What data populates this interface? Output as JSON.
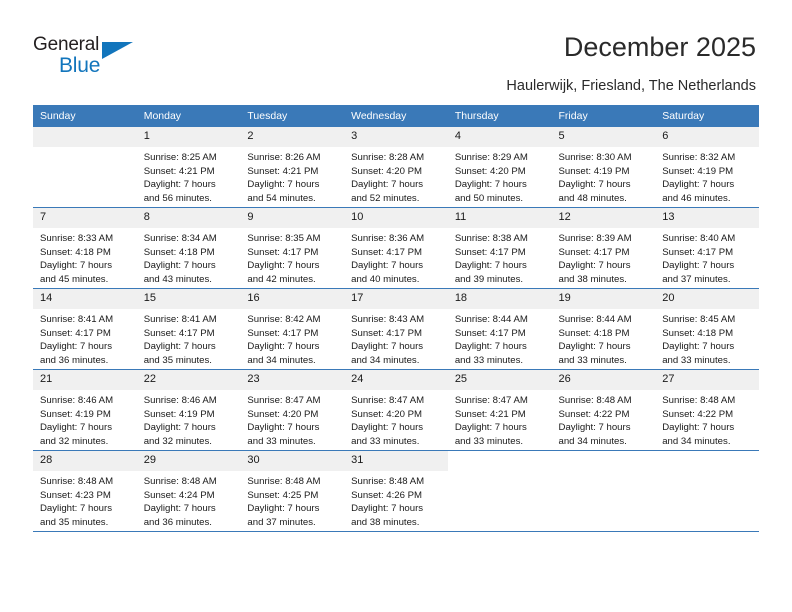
{
  "brand": {
    "name_top": "General",
    "name_bottom": "Blue",
    "triangle_color": "#1275bc"
  },
  "header": {
    "title": "December 2025",
    "subtitle": "Haulerwijk, Friesland, The Netherlands",
    "header_bg": "#3a79b8"
  },
  "weekdays": [
    "Sunday",
    "Monday",
    "Tuesday",
    "Wednesday",
    "Thursday",
    "Friday",
    "Saturday"
  ],
  "weeks": [
    [
      {
        "day": "",
        "sunrise": "",
        "sunset": "",
        "daylight1": "",
        "daylight2": "",
        "empty": true
      },
      {
        "day": "1",
        "sunrise": "Sunrise: 8:25 AM",
        "sunset": "Sunset: 4:21 PM",
        "daylight1": "Daylight: 7 hours",
        "daylight2": "and 56 minutes."
      },
      {
        "day": "2",
        "sunrise": "Sunrise: 8:26 AM",
        "sunset": "Sunset: 4:21 PM",
        "daylight1": "Daylight: 7 hours",
        "daylight2": "and 54 minutes."
      },
      {
        "day": "3",
        "sunrise": "Sunrise: 8:28 AM",
        "sunset": "Sunset: 4:20 PM",
        "daylight1": "Daylight: 7 hours",
        "daylight2": "and 52 minutes."
      },
      {
        "day": "4",
        "sunrise": "Sunrise: 8:29 AM",
        "sunset": "Sunset: 4:20 PM",
        "daylight1": "Daylight: 7 hours",
        "daylight2": "and 50 minutes."
      },
      {
        "day": "5",
        "sunrise": "Sunrise: 8:30 AM",
        "sunset": "Sunset: 4:19 PM",
        "daylight1": "Daylight: 7 hours",
        "daylight2": "and 48 minutes."
      },
      {
        "day": "6",
        "sunrise": "Sunrise: 8:32 AM",
        "sunset": "Sunset: 4:19 PM",
        "daylight1": "Daylight: 7 hours",
        "daylight2": "and 46 minutes."
      }
    ],
    [
      {
        "day": "7",
        "sunrise": "Sunrise: 8:33 AM",
        "sunset": "Sunset: 4:18 PM",
        "daylight1": "Daylight: 7 hours",
        "daylight2": "and 45 minutes."
      },
      {
        "day": "8",
        "sunrise": "Sunrise: 8:34 AM",
        "sunset": "Sunset: 4:18 PM",
        "daylight1": "Daylight: 7 hours",
        "daylight2": "and 43 minutes."
      },
      {
        "day": "9",
        "sunrise": "Sunrise: 8:35 AM",
        "sunset": "Sunset: 4:17 PM",
        "daylight1": "Daylight: 7 hours",
        "daylight2": "and 42 minutes."
      },
      {
        "day": "10",
        "sunrise": "Sunrise: 8:36 AM",
        "sunset": "Sunset: 4:17 PM",
        "daylight1": "Daylight: 7 hours",
        "daylight2": "and 40 minutes."
      },
      {
        "day": "11",
        "sunrise": "Sunrise: 8:38 AM",
        "sunset": "Sunset: 4:17 PM",
        "daylight1": "Daylight: 7 hours",
        "daylight2": "and 39 minutes."
      },
      {
        "day": "12",
        "sunrise": "Sunrise: 8:39 AM",
        "sunset": "Sunset: 4:17 PM",
        "daylight1": "Daylight: 7 hours",
        "daylight2": "and 38 minutes."
      },
      {
        "day": "13",
        "sunrise": "Sunrise: 8:40 AM",
        "sunset": "Sunset: 4:17 PM",
        "daylight1": "Daylight: 7 hours",
        "daylight2": "and 37 minutes."
      }
    ],
    [
      {
        "day": "14",
        "sunrise": "Sunrise: 8:41 AM",
        "sunset": "Sunset: 4:17 PM",
        "daylight1": "Daylight: 7 hours",
        "daylight2": "and 36 minutes."
      },
      {
        "day": "15",
        "sunrise": "Sunrise: 8:41 AM",
        "sunset": "Sunset: 4:17 PM",
        "daylight1": "Daylight: 7 hours",
        "daylight2": "and 35 minutes."
      },
      {
        "day": "16",
        "sunrise": "Sunrise: 8:42 AM",
        "sunset": "Sunset: 4:17 PM",
        "daylight1": "Daylight: 7 hours",
        "daylight2": "and 34 minutes."
      },
      {
        "day": "17",
        "sunrise": "Sunrise: 8:43 AM",
        "sunset": "Sunset: 4:17 PM",
        "daylight1": "Daylight: 7 hours",
        "daylight2": "and 34 minutes."
      },
      {
        "day": "18",
        "sunrise": "Sunrise: 8:44 AM",
        "sunset": "Sunset: 4:17 PM",
        "daylight1": "Daylight: 7 hours",
        "daylight2": "and 33 minutes."
      },
      {
        "day": "19",
        "sunrise": "Sunrise: 8:44 AM",
        "sunset": "Sunset: 4:18 PM",
        "daylight1": "Daylight: 7 hours",
        "daylight2": "and 33 minutes."
      },
      {
        "day": "20",
        "sunrise": "Sunrise: 8:45 AM",
        "sunset": "Sunset: 4:18 PM",
        "daylight1": "Daylight: 7 hours",
        "daylight2": "and 33 minutes."
      }
    ],
    [
      {
        "day": "21",
        "sunrise": "Sunrise: 8:46 AM",
        "sunset": "Sunset: 4:19 PM",
        "daylight1": "Daylight: 7 hours",
        "daylight2": "and 32 minutes."
      },
      {
        "day": "22",
        "sunrise": "Sunrise: 8:46 AM",
        "sunset": "Sunset: 4:19 PM",
        "daylight1": "Daylight: 7 hours",
        "daylight2": "and 32 minutes."
      },
      {
        "day": "23",
        "sunrise": "Sunrise: 8:47 AM",
        "sunset": "Sunset: 4:20 PM",
        "daylight1": "Daylight: 7 hours",
        "daylight2": "and 33 minutes."
      },
      {
        "day": "24",
        "sunrise": "Sunrise: 8:47 AM",
        "sunset": "Sunset: 4:20 PM",
        "daylight1": "Daylight: 7 hours",
        "daylight2": "and 33 minutes."
      },
      {
        "day": "25",
        "sunrise": "Sunrise: 8:47 AM",
        "sunset": "Sunset: 4:21 PM",
        "daylight1": "Daylight: 7 hours",
        "daylight2": "and 33 minutes."
      },
      {
        "day": "26",
        "sunrise": "Sunrise: 8:48 AM",
        "sunset": "Sunset: 4:22 PM",
        "daylight1": "Daylight: 7 hours",
        "daylight2": "and 34 minutes."
      },
      {
        "day": "27",
        "sunrise": "Sunrise: 8:48 AM",
        "sunset": "Sunset: 4:22 PM",
        "daylight1": "Daylight: 7 hours",
        "daylight2": "and 34 minutes."
      }
    ],
    [
      {
        "day": "28",
        "sunrise": "Sunrise: 8:48 AM",
        "sunset": "Sunset: 4:23 PM",
        "daylight1": "Daylight: 7 hours",
        "daylight2": "and 35 minutes."
      },
      {
        "day": "29",
        "sunrise": "Sunrise: 8:48 AM",
        "sunset": "Sunset: 4:24 PM",
        "daylight1": "Daylight: 7 hours",
        "daylight2": "and 36 minutes."
      },
      {
        "day": "30",
        "sunrise": "Sunrise: 8:48 AM",
        "sunset": "Sunset: 4:25 PM",
        "daylight1": "Daylight: 7 hours",
        "daylight2": "and 37 minutes."
      },
      {
        "day": "31",
        "sunrise": "Sunrise: 8:48 AM",
        "sunset": "Sunset: 4:26 PM",
        "daylight1": "Daylight: 7 hours",
        "daylight2": "and 38 minutes."
      },
      {
        "day": "",
        "sunrise": "",
        "sunset": "",
        "daylight1": "",
        "daylight2": "",
        "blank": true
      },
      {
        "day": "",
        "sunrise": "",
        "sunset": "",
        "daylight1": "",
        "daylight2": "",
        "blank": true
      },
      {
        "day": "",
        "sunrise": "",
        "sunset": "",
        "daylight1": "",
        "daylight2": "",
        "blank": true
      }
    ]
  ]
}
